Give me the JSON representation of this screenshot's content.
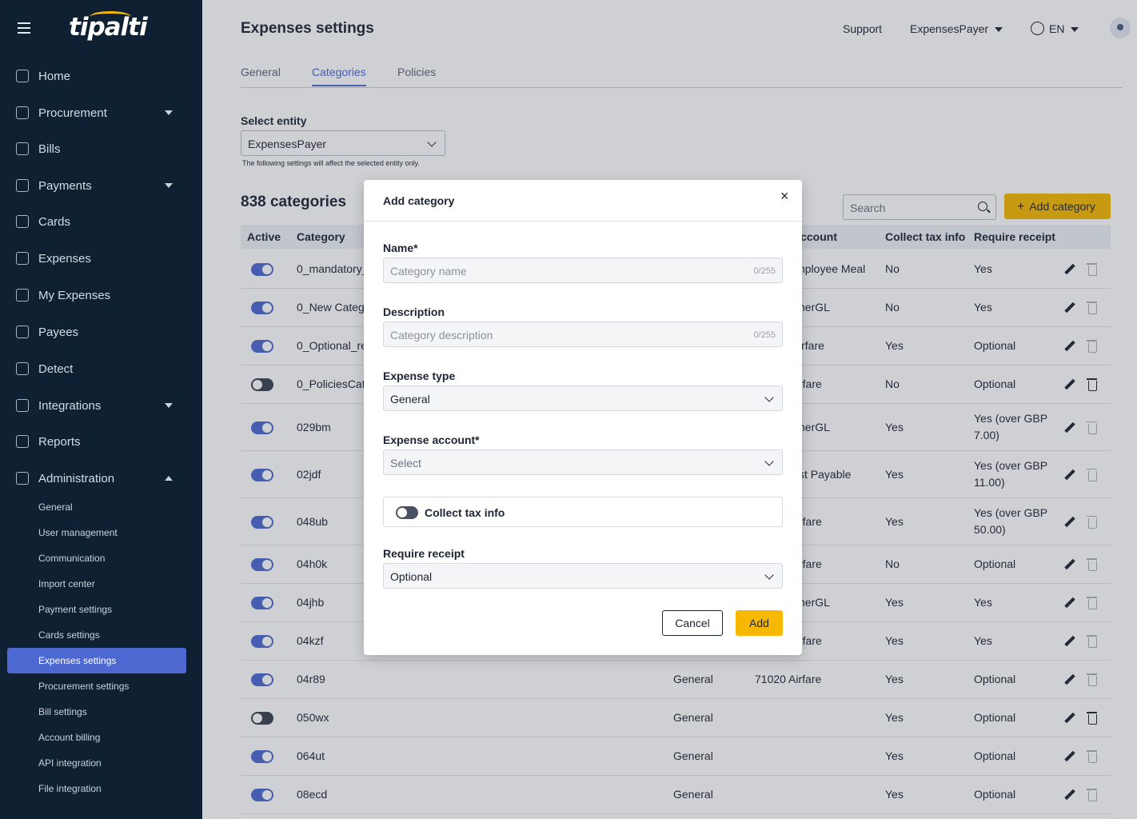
{
  "brand": {
    "logo_text": "tipalti",
    "accent": "#4d68d0",
    "sidebar_bg": "#0f2033",
    "cta": "#f6b800"
  },
  "sidebar": {
    "items": [
      {
        "label": "Home",
        "icon": "home-icon",
        "caret": ""
      },
      {
        "label": "Procurement",
        "icon": "bag-icon",
        "caret": "down"
      },
      {
        "label": "Bills",
        "icon": "bill-icon",
        "caret": ""
      },
      {
        "label": "Payments",
        "icon": "money-bag-icon",
        "caret": "down"
      },
      {
        "label": "Cards",
        "icon": "card-icon",
        "caret": ""
      },
      {
        "label": "Expenses",
        "icon": "wallet-icon",
        "caret": ""
      },
      {
        "label": "My Expenses",
        "icon": "wallet-icon",
        "caret": ""
      },
      {
        "label": "Payees",
        "icon": "people-icon",
        "caret": ""
      },
      {
        "label": "Detect",
        "icon": "detect-icon",
        "caret": ""
      },
      {
        "label": "Integrations",
        "icon": "sync-icon",
        "caret": "down"
      },
      {
        "label": "Reports",
        "icon": "chart-icon",
        "caret": ""
      },
      {
        "label": "Administration",
        "icon": "list-icon",
        "caret": "up"
      }
    ],
    "sub_items": [
      "General",
      "User management",
      "Communication",
      "Import center",
      "Payment settings",
      "Cards settings",
      "Expenses settings",
      "Procurement settings",
      "Bill settings",
      "Account billing",
      "API integration",
      "File integration"
    ],
    "active_sub": "Expenses settings"
  },
  "header": {
    "title": "Expenses settings",
    "support": "Support",
    "payer": "ExpensesPayer",
    "lang": "EN"
  },
  "tabs": [
    "General",
    "Categories",
    "Policies"
  ],
  "active_tab": "Categories",
  "entity": {
    "label": "Select entity",
    "value": "ExpensesPayer",
    "hint": "The following settings will affect the selected entity only."
  },
  "list": {
    "count": "838 categories",
    "search_placeholder": "Search",
    "add_label": "Add category",
    "headers": {
      "active": "Active",
      "category": "Category",
      "account": "Account",
      "tax": "Collect tax info",
      "receipt": "Require receipt"
    },
    "rows": [
      {
        "active": true,
        "category": "0_mandatory_",
        "type": "",
        "account": "nployee Meal",
        "tax": "No",
        "receipt": "Yes",
        "receipt2": ""
      },
      {
        "active": true,
        "category": "0_New Catego",
        "type": "",
        "account": "herGL",
        "tax": "No",
        "receipt": "Yes",
        "receipt2": ""
      },
      {
        "active": true,
        "category": "0_Optional_re",
        "type": "",
        "account": "irfare",
        "tax": "Yes",
        "receipt": "Optional",
        "receipt2": ""
      },
      {
        "active": false,
        "category": "0_PoliciesCate",
        "type": "",
        "account": "rfare",
        "tax": "No",
        "receipt": "Optional",
        "receipt2": ""
      },
      {
        "active": true,
        "category": "029bm",
        "type": "",
        "account": "herGL",
        "tax": "Yes",
        "receipt": "Yes (over GBP",
        "receipt2": "7.00)"
      },
      {
        "active": true,
        "category": "02jdf",
        "type": "",
        "account": "st Payable",
        "tax": "Yes",
        "receipt": "Yes (over GBP",
        "receipt2": "11.00)"
      },
      {
        "active": true,
        "category": "048ub",
        "type": "",
        "account": "rfare",
        "tax": "Yes",
        "receipt": "Yes (over GBP",
        "receipt2": "50.00)"
      },
      {
        "active": true,
        "category": "04h0k",
        "type": "",
        "account": "rfare",
        "tax": "No",
        "receipt": "Optional",
        "receipt2": ""
      },
      {
        "active": true,
        "category": "04jhb",
        "type": "",
        "account": "herGL",
        "tax": "Yes",
        "receipt": "Yes",
        "receipt2": ""
      },
      {
        "active": true,
        "category": "04kzf",
        "type": "",
        "account": "rfare",
        "tax": "Yes",
        "receipt": "Yes",
        "receipt2": ""
      },
      {
        "active": true,
        "category": "04r89",
        "type": "General",
        "account": "71020 Airfare",
        "tax": "Yes",
        "receipt": "Optional",
        "receipt2": ""
      },
      {
        "active": false,
        "category": "050wx",
        "type": "General",
        "account": "",
        "tax": "Yes",
        "receipt": "Optional",
        "receipt2": ""
      },
      {
        "active": true,
        "category": "064ut",
        "type": "General",
        "account": "",
        "tax": "Yes",
        "receipt": "Optional",
        "receipt2": ""
      },
      {
        "active": true,
        "category": "08ecd",
        "type": "General",
        "account": "",
        "tax": "Yes",
        "receipt": "Optional",
        "receipt2": ""
      }
    ]
  },
  "modal": {
    "title": "Add category",
    "name_label": "Name*",
    "name_placeholder": "Category name",
    "name_count": "0/255",
    "desc_label": "Description",
    "desc_placeholder": "Category description",
    "desc_count": "0/255",
    "type_label": "Expense type",
    "type_value": "General",
    "account_label": "Expense account*",
    "account_value": "Select",
    "tax_label": "Collect tax info",
    "receipt_label": "Require receipt",
    "receipt_value": "Optional",
    "cancel": "Cancel",
    "add": "Add"
  }
}
